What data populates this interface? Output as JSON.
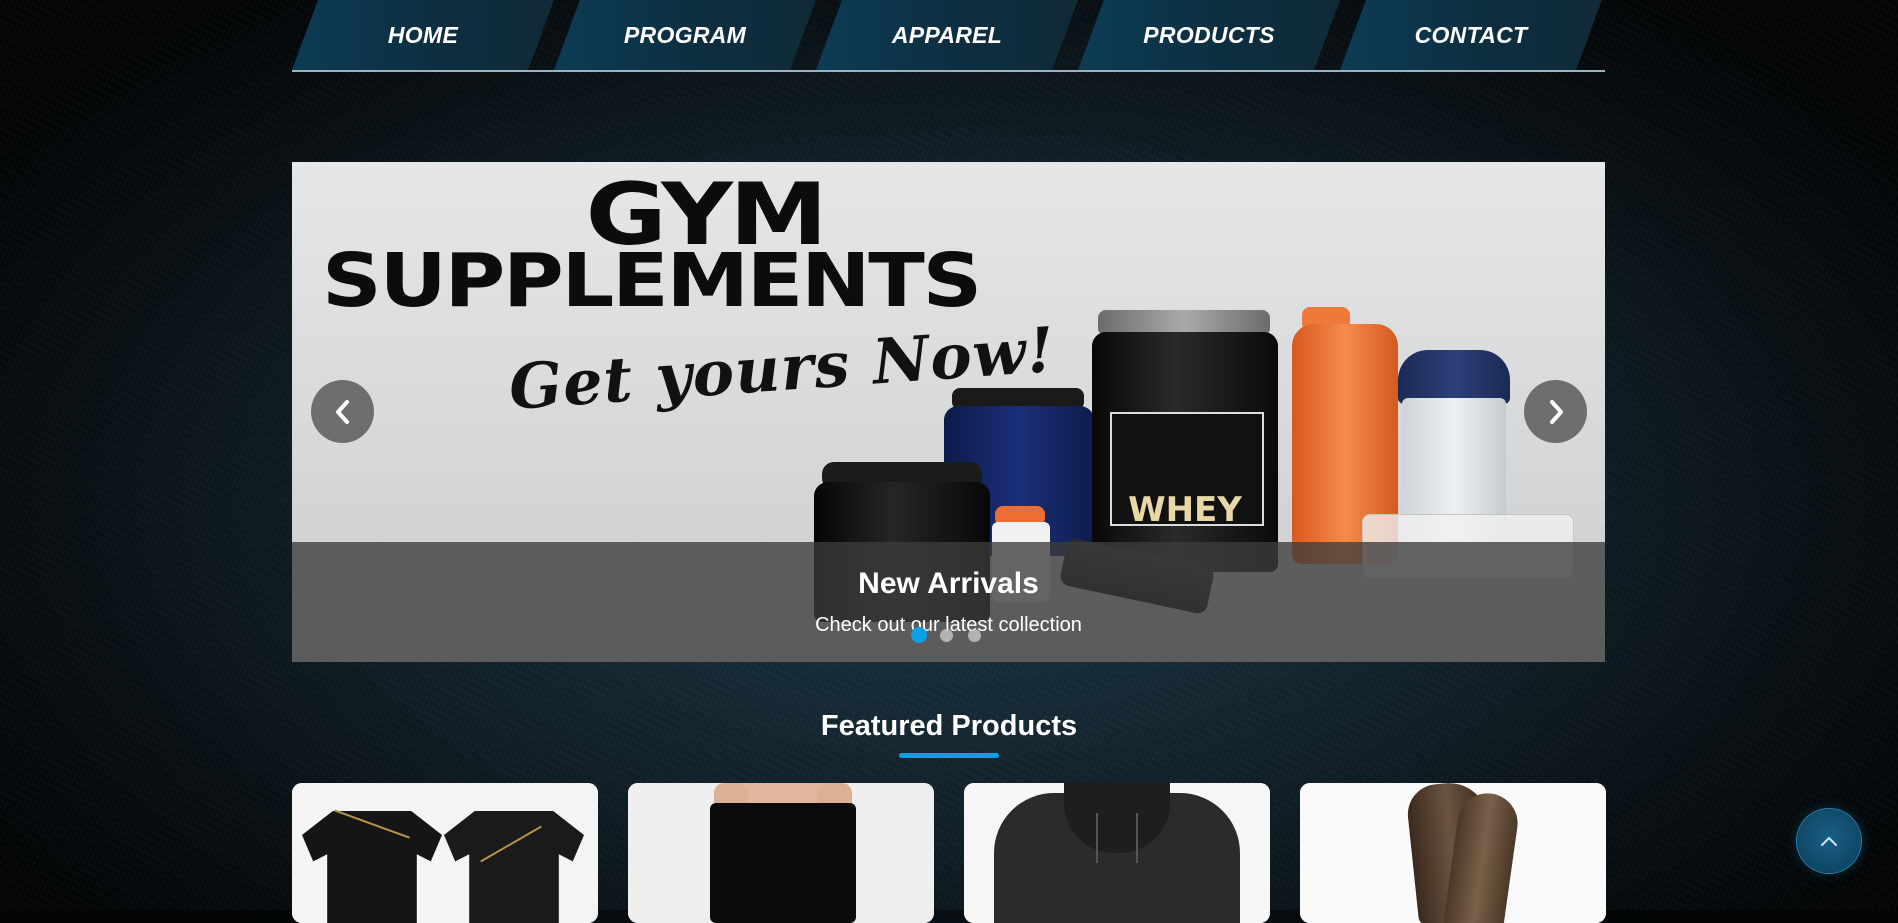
{
  "nav": {
    "items": [
      {
        "label": "HOME"
      },
      {
        "label": "PROGRAM"
      },
      {
        "label": "APPAREL"
      },
      {
        "label": "PRODUCTS"
      },
      {
        "label": "CONTACT"
      }
    ]
  },
  "slider": {
    "banner": {
      "line1": "GYM",
      "line2": "SUPPLEMENTS",
      "script": "Get yours Now!",
      "tub_label": "WHEY"
    },
    "caption": {
      "title": "New Arrivals",
      "subtitle": "Check out our latest collection"
    },
    "active_index": 0,
    "slide_count": 3
  },
  "featured": {
    "title": "Featured Products"
  },
  "colors": {
    "accent": "#0aa0e6",
    "nav_bg": "#0c3c55"
  }
}
